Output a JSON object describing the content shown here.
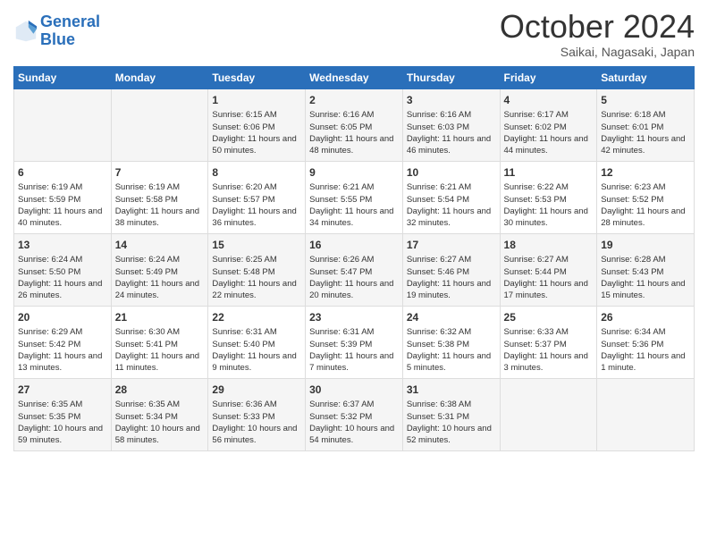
{
  "header": {
    "logo_line1": "General",
    "logo_line2": "Blue",
    "month": "October 2024",
    "location": "Saikai, Nagasaki, Japan"
  },
  "weekdays": [
    "Sunday",
    "Monday",
    "Tuesday",
    "Wednesday",
    "Thursday",
    "Friday",
    "Saturday"
  ],
  "rows": [
    [
      {
        "day": "",
        "content": ""
      },
      {
        "day": "",
        "content": ""
      },
      {
        "day": "1",
        "content": "Sunrise: 6:15 AM\nSunset: 6:06 PM\nDaylight: 11 hours and 50 minutes."
      },
      {
        "day": "2",
        "content": "Sunrise: 6:16 AM\nSunset: 6:05 PM\nDaylight: 11 hours and 48 minutes."
      },
      {
        "day": "3",
        "content": "Sunrise: 6:16 AM\nSunset: 6:03 PM\nDaylight: 11 hours and 46 minutes."
      },
      {
        "day": "4",
        "content": "Sunrise: 6:17 AM\nSunset: 6:02 PM\nDaylight: 11 hours and 44 minutes."
      },
      {
        "day": "5",
        "content": "Sunrise: 6:18 AM\nSunset: 6:01 PM\nDaylight: 11 hours and 42 minutes."
      }
    ],
    [
      {
        "day": "6",
        "content": "Sunrise: 6:19 AM\nSunset: 5:59 PM\nDaylight: 11 hours and 40 minutes."
      },
      {
        "day": "7",
        "content": "Sunrise: 6:19 AM\nSunset: 5:58 PM\nDaylight: 11 hours and 38 minutes."
      },
      {
        "day": "8",
        "content": "Sunrise: 6:20 AM\nSunset: 5:57 PM\nDaylight: 11 hours and 36 minutes."
      },
      {
        "day": "9",
        "content": "Sunrise: 6:21 AM\nSunset: 5:55 PM\nDaylight: 11 hours and 34 minutes."
      },
      {
        "day": "10",
        "content": "Sunrise: 6:21 AM\nSunset: 5:54 PM\nDaylight: 11 hours and 32 minutes."
      },
      {
        "day": "11",
        "content": "Sunrise: 6:22 AM\nSunset: 5:53 PM\nDaylight: 11 hours and 30 minutes."
      },
      {
        "day": "12",
        "content": "Sunrise: 6:23 AM\nSunset: 5:52 PM\nDaylight: 11 hours and 28 minutes."
      }
    ],
    [
      {
        "day": "13",
        "content": "Sunrise: 6:24 AM\nSunset: 5:50 PM\nDaylight: 11 hours and 26 minutes."
      },
      {
        "day": "14",
        "content": "Sunrise: 6:24 AM\nSunset: 5:49 PM\nDaylight: 11 hours and 24 minutes."
      },
      {
        "day": "15",
        "content": "Sunrise: 6:25 AM\nSunset: 5:48 PM\nDaylight: 11 hours and 22 minutes."
      },
      {
        "day": "16",
        "content": "Sunrise: 6:26 AM\nSunset: 5:47 PM\nDaylight: 11 hours and 20 minutes."
      },
      {
        "day": "17",
        "content": "Sunrise: 6:27 AM\nSunset: 5:46 PM\nDaylight: 11 hours and 19 minutes."
      },
      {
        "day": "18",
        "content": "Sunrise: 6:27 AM\nSunset: 5:44 PM\nDaylight: 11 hours and 17 minutes."
      },
      {
        "day": "19",
        "content": "Sunrise: 6:28 AM\nSunset: 5:43 PM\nDaylight: 11 hours and 15 minutes."
      }
    ],
    [
      {
        "day": "20",
        "content": "Sunrise: 6:29 AM\nSunset: 5:42 PM\nDaylight: 11 hours and 13 minutes."
      },
      {
        "day": "21",
        "content": "Sunrise: 6:30 AM\nSunset: 5:41 PM\nDaylight: 11 hours and 11 minutes."
      },
      {
        "day": "22",
        "content": "Sunrise: 6:31 AM\nSunset: 5:40 PM\nDaylight: 11 hours and 9 minutes."
      },
      {
        "day": "23",
        "content": "Sunrise: 6:31 AM\nSunset: 5:39 PM\nDaylight: 11 hours and 7 minutes."
      },
      {
        "day": "24",
        "content": "Sunrise: 6:32 AM\nSunset: 5:38 PM\nDaylight: 11 hours and 5 minutes."
      },
      {
        "day": "25",
        "content": "Sunrise: 6:33 AM\nSunset: 5:37 PM\nDaylight: 11 hours and 3 minutes."
      },
      {
        "day": "26",
        "content": "Sunrise: 6:34 AM\nSunset: 5:36 PM\nDaylight: 11 hours and 1 minute."
      }
    ],
    [
      {
        "day": "27",
        "content": "Sunrise: 6:35 AM\nSunset: 5:35 PM\nDaylight: 10 hours and 59 minutes."
      },
      {
        "day": "28",
        "content": "Sunrise: 6:35 AM\nSunset: 5:34 PM\nDaylight: 10 hours and 58 minutes."
      },
      {
        "day": "29",
        "content": "Sunrise: 6:36 AM\nSunset: 5:33 PM\nDaylight: 10 hours and 56 minutes."
      },
      {
        "day": "30",
        "content": "Sunrise: 6:37 AM\nSunset: 5:32 PM\nDaylight: 10 hours and 54 minutes."
      },
      {
        "day": "31",
        "content": "Sunrise: 6:38 AM\nSunset: 5:31 PM\nDaylight: 10 hours and 52 minutes."
      },
      {
        "day": "",
        "content": ""
      },
      {
        "day": "",
        "content": ""
      }
    ]
  ]
}
